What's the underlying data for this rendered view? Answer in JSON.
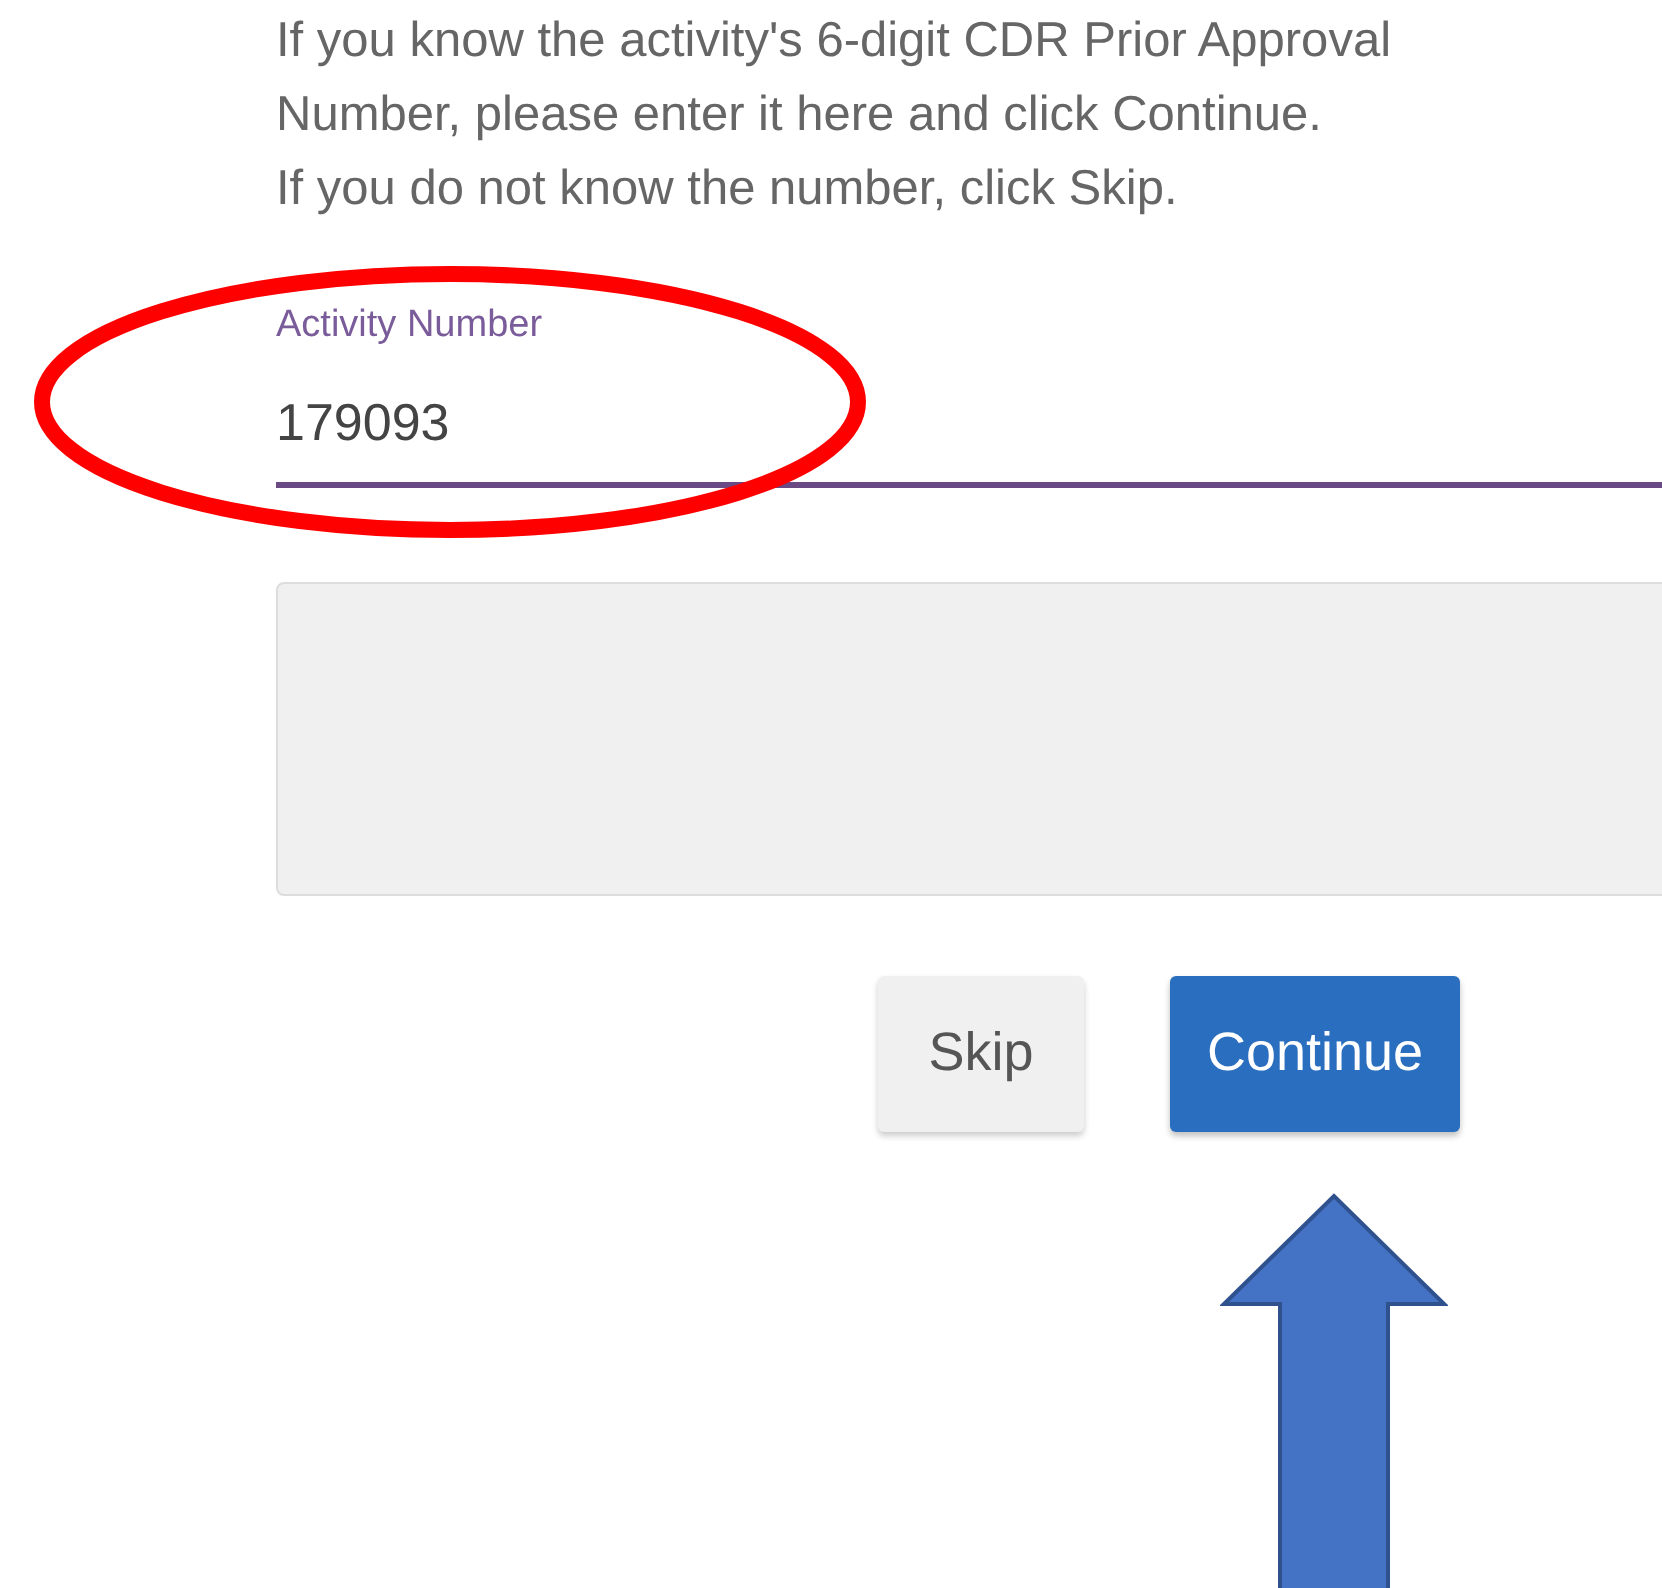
{
  "instructions": [
    "If you know the activity's 6-digit CDR Prior Approval",
    "Number, please enter it here and click Continue.",
    "If you do not know the number, click Skip."
  ],
  "field": {
    "label": "Activity Number",
    "value": "179093",
    "focused": true
  },
  "buttons": [
    {
      "label": "Skip",
      "kind": "secondary"
    },
    {
      "label": "Continue",
      "kind": "primary"
    }
  ]
}
